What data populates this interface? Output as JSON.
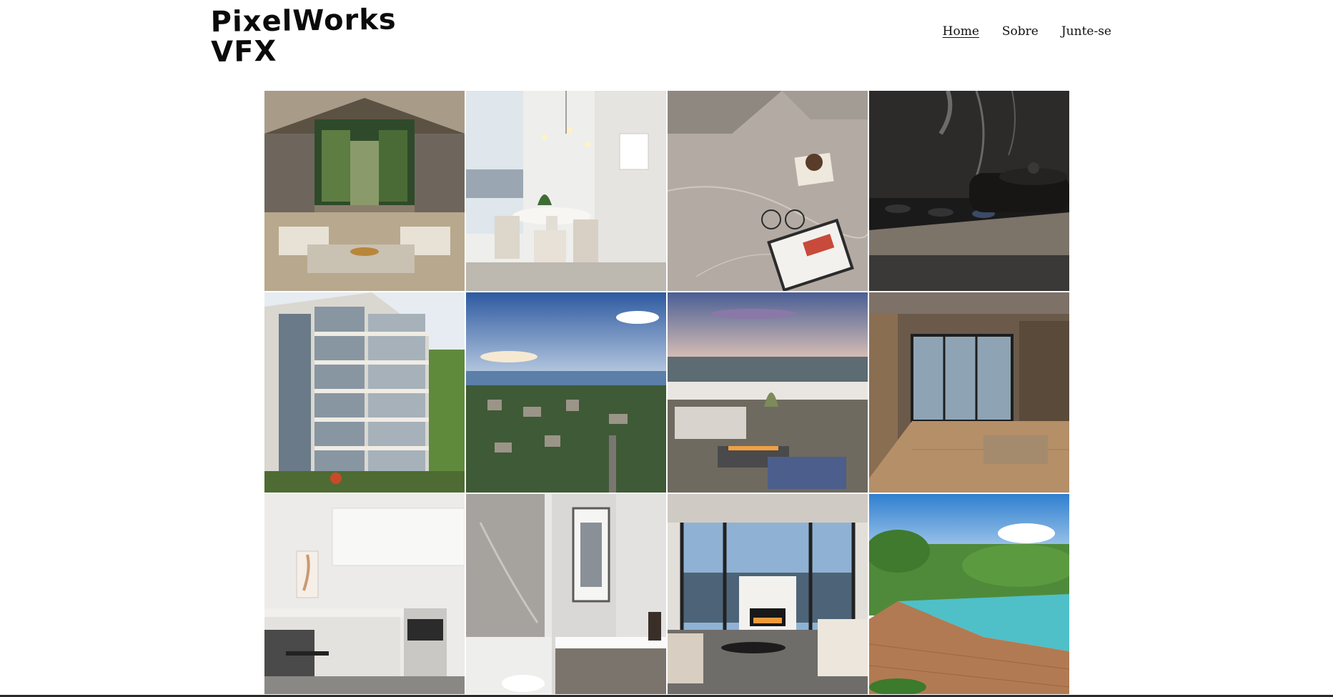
{
  "brand": {
    "name_line1": "PixelWorks",
    "name_line2": "VFX"
  },
  "nav": {
    "items": [
      {
        "label": "Home",
        "active": true
      },
      {
        "label": "Sobre",
        "active": false
      },
      {
        "label": "Junte-se",
        "active": false
      }
    ]
  },
  "gallery": {
    "images": [
      {
        "subject": "living-room-vaulted-ceiling"
      },
      {
        "subject": "dining-room-city-view"
      },
      {
        "subject": "marble-countertop-glasses-tablet"
      },
      {
        "subject": "gas-cooktop-pot"
      },
      {
        "subject": "condo-building-exterior"
      },
      {
        "subject": "aerial-city-harbor-view"
      },
      {
        "subject": "rooftop-terrace-fire-table"
      },
      {
        "subject": "living-room-terrace-doors"
      },
      {
        "subject": "white-kitchen-island"
      },
      {
        "subject": "bathroom-vanity-shower"
      },
      {
        "subject": "living-room-fireplace-view"
      },
      {
        "subject": "infinity-pool-deck"
      }
    ]
  }
}
